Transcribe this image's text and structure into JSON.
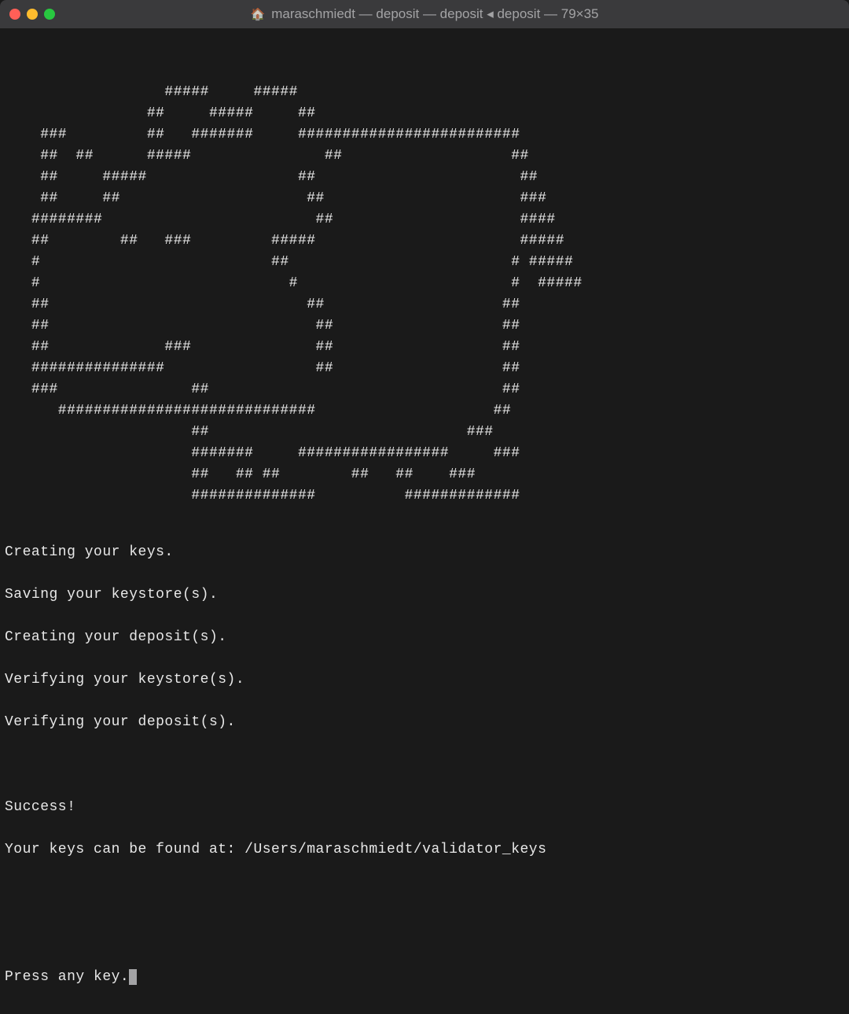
{
  "window": {
    "title": "maraschmiedt — deposit — deposit ◂ deposit — 79×35"
  },
  "terminal": {
    "ascii_art": "\n                  #####     #####\n                ##     #####     ##\n    ###         ##   #######     #########################\n    ##  ##      #####               ##                   ##\n    ##     #####                 ##                       ##\n    ##     ##                     ##                      ###\n   ########                        ##                     ####\n   ##        ##   ###         #####                       #####\n   #                          ##                         # #####\n   #                            #                        #  #####\n   ##                             ##                    ##\n   ##                              ##                   ##\n   ##             ###              ##                   ##\n   ###############                 ##                   ##\n   ###               ##                                 ##\n      #############################                    ##\n                     ##                             ###\n                     #######     #################     ###\n                     ##   ## ##        ##   ##    ###\n                     ##############          #############",
    "status_lines": [
      "Creating your keys.",
      "Saving your keystore(s).",
      "Creating your deposit(s).",
      "Verifying your keystore(s).",
      "Verifying your deposit(s)."
    ],
    "success_line": "Success!",
    "location_line": "Your keys can be found at: /Users/maraschmiedt/validator_keys",
    "prompt": "Press any key."
  }
}
